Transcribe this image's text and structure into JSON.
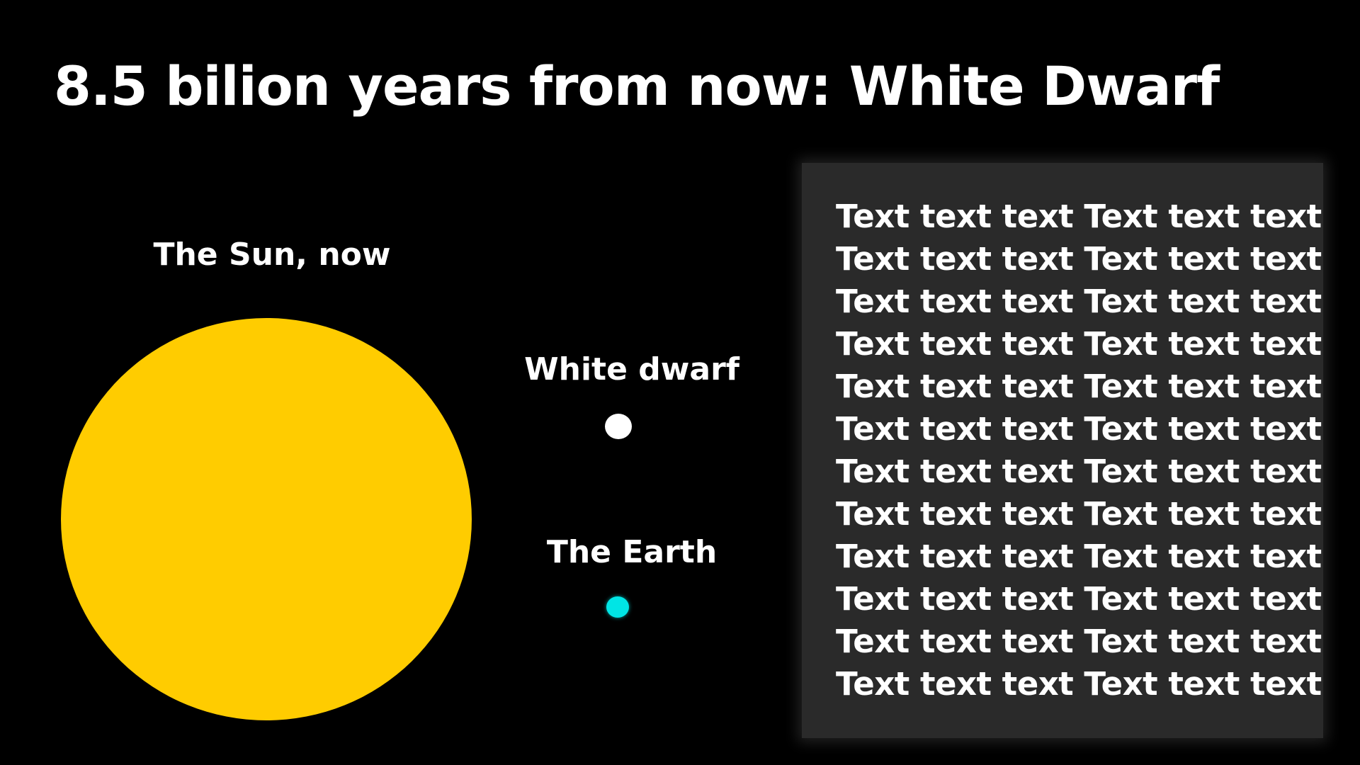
{
  "slide": {
    "title": "8.5 bilion years from now: White Dwarf"
  },
  "labels": {
    "sun": "The Sun, now",
    "dwarf": "White dwarf",
    "earth": "The Earth"
  },
  "colors": {
    "background": "#000000",
    "sun": "#ffcc00",
    "white_dwarf": "#ffffff",
    "earth": "#00e5e5",
    "panel": "#2a2a2a"
  },
  "text_panel": {
    "lines": [
      "Text text text Text text text",
      "Text text text Text text text",
      "Text text text Text text text",
      "Text text text Text text text",
      "Text text text Text text text",
      "Text text text Text text text",
      "Text text text Text text text",
      "Text text text Text text text",
      "Text text text Text text text",
      "Text text text Text text text",
      "Text text text Text text text",
      "Text text text Text text text"
    ]
  }
}
